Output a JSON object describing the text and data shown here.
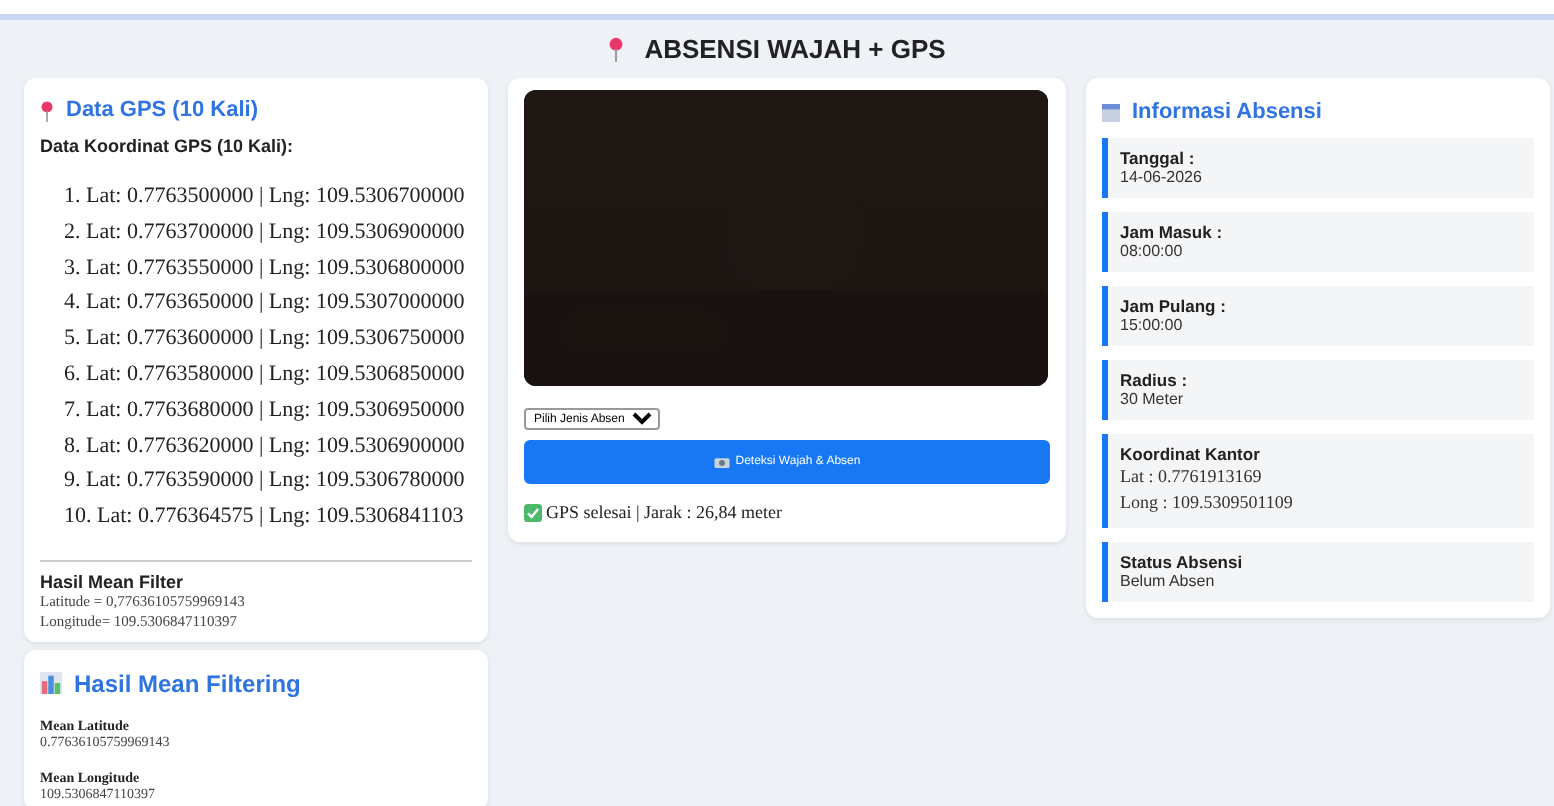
{
  "header": {
    "title": "ABSENSI WAJAH + GPS"
  },
  "gps_card": {
    "title": "Data GPS (10 Kali)",
    "subtitle": "Data Koordinat GPS (10 Kali):",
    "points": [
      "1. Lat: 0.7763500000 | Lng: 109.5306700000",
      "2. Lat: 0.7763700000 | Lng: 109.5306900000",
      "3. Lat: 0.7763550000 | Lng: 109.5306800000",
      "4. Lat: 0.7763650000 | Lng: 109.5307000000",
      "5. Lat: 0.7763600000 | Lng: 109.5306750000",
      "6. Lat: 0.7763580000 | Lng: 109.5306850000",
      "7. Lat: 0.7763680000 | Lng: 109.5306950000",
      "8. Lat: 0.7763620000 | Lng: 109.5306900000",
      "9. Lat: 0.7763590000 | Lng: 109.5306780000",
      "10. Lat: 0.776364575 | Lng: 109.5306841103"
    ],
    "mean_filter": {
      "title": "Hasil Mean Filter",
      "lines": [
        "Latitude = 0,77636105759969143",
        "Longitude= 109.5306847110397"
      ]
    }
  },
  "mean_card": {
    "title": "Hasil Mean Filtering",
    "fields": [
      {
        "label": "Mean Latitude",
        "value": "0.77636105759969143"
      },
      {
        "label": "Mean Longitude",
        "value": "109.5306847110397"
      }
    ]
  },
  "select": {
    "value": "Pilih Jenis Absen"
  },
  "button": {
    "label": "Deteksi Wajah & Absen"
  },
  "status": {
    "text": "GPS selesai | Jarak : 26,84 meter"
  },
  "info": {
    "title": "Informasi Absensi",
    "items": [
      {
        "kind": "plain",
        "label": "Tanggal :",
        "lines": [
          "14-06-2026"
        ]
      },
      {
        "kind": "plain",
        "label": "Jam Masuk :",
        "lines": [
          "08:00:00"
        ]
      },
      {
        "kind": "plain",
        "label": "Jam Pulang :",
        "lines": [
          "15:00:00"
        ]
      },
      {
        "kind": "plain",
        "label": "Radius :",
        "lines": [
          "30 Meter"
        ]
      },
      {
        "kind": "coords",
        "label": "Koordinat Kantor",
        "lines": [
          "Lat : 0.7761913169",
          "Long : 109.5309501109"
        ]
      },
      {
        "kind": "plain",
        "label": "Status Absensi",
        "lines": [
          "Belum Absen"
        ]
      }
    ]
  }
}
